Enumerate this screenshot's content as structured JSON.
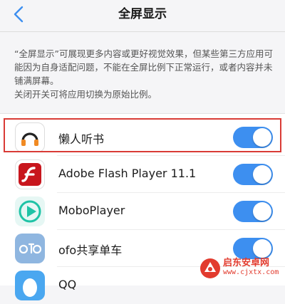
{
  "header": {
    "title": "全屏显示",
    "back_icon": "chevron-left-icon"
  },
  "description": {
    "line1": "“全屏显示”可展现更多内容或更好视觉效果，但某些第三方应用可能因为自身适配问题，不能在全屏比例下正常运行，或者内容并未铺满屏幕。",
    "line2": "关闭开关可将应用切换为原始比例。"
  },
  "apps": [
    {
      "name": "懒人听书",
      "icon": "headphones-icon",
      "enabled": true,
      "highlighted": true
    },
    {
      "name": "Adobe Flash Player 11.1",
      "icon": "flash-icon",
      "enabled": true,
      "highlighted": false
    },
    {
      "name": "MoboPlayer",
      "icon": "play-icon",
      "enabled": true,
      "highlighted": false
    },
    {
      "name": "ofo共享单车",
      "icon": "ofo-icon",
      "enabled": true,
      "highlighted": false
    },
    {
      "name": "QQ",
      "icon": "qq-penguin-icon",
      "enabled": true,
      "highlighted": false
    }
  ],
  "watermark": {
    "text": "启东安卓网",
    "url": "www.cjxtx.com"
  },
  "colors": {
    "toggle_on": "#3d8ff0",
    "highlight_border": "#d93b36",
    "page_background": "#f5f5f7"
  }
}
